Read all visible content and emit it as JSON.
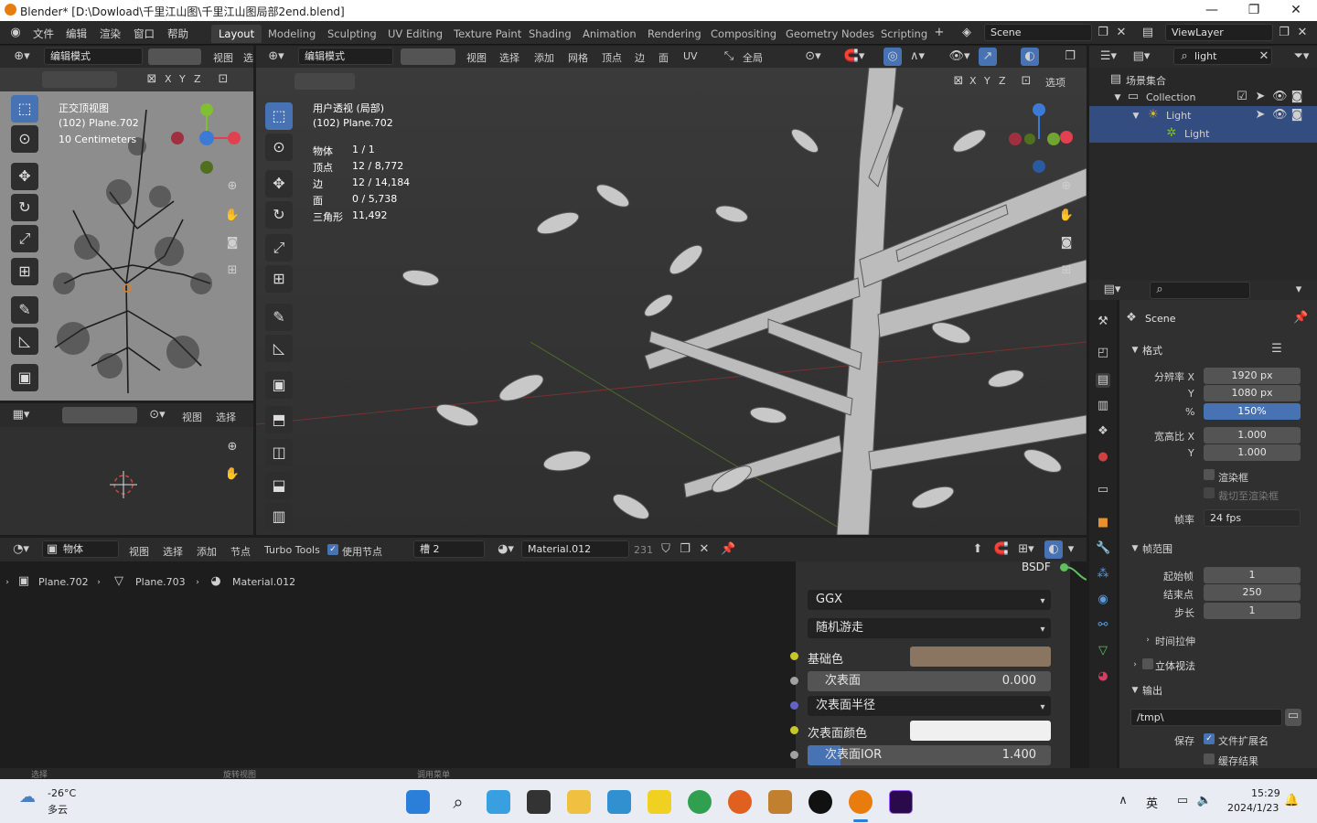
{
  "window": {
    "title": "Blender* [D:\\Dowload\\千里江山图\\千里江山图局部2end.blend]",
    "min": "—",
    "max": "❐",
    "close": "✕"
  },
  "menu": [
    "文件",
    "编辑",
    "渲染",
    "窗口",
    "帮助"
  ],
  "workspaces": [
    "Layout",
    "Modeling",
    "Sculpting",
    "UV Editing",
    "Texture Paint",
    "Shading",
    "Animation",
    "Rendering",
    "Compositing",
    "Geometry Nodes",
    "Scripting"
  ],
  "scene_field": "Scene",
  "viewlayer_field": "ViewLayer",
  "left_viewport": {
    "mode": "编辑模式",
    "menu": [
      "视图",
      "选"
    ],
    "axes": [
      "X",
      "Y",
      "Z"
    ],
    "info": [
      "正交顶视图",
      "(102) Plane.702",
      "10 Centimeters"
    ]
  },
  "uv_editor": {
    "menu": [
      "视图",
      "选择"
    ]
  },
  "main_viewport": {
    "mode": "编辑模式",
    "menu": [
      "视图",
      "选择",
      "添加",
      "网格",
      "顶点",
      "边",
      "面",
      "UV"
    ],
    "transform": "全局",
    "axes": [
      "X",
      "Y",
      "Z"
    ],
    "options": "选项",
    "view_name": "用户透视 (局部)",
    "object_name": "(102) Plane.702",
    "stats": [
      {
        "label": "物体",
        "value": "1 / 1"
      },
      {
        "label": "顶点",
        "value": "12 / 8,772"
      },
      {
        "label": "边",
        "value": "12 / 14,184"
      },
      {
        "label": "面",
        "value": "0 / 5,738"
      },
      {
        "label": "三角形",
        "value": "11,492"
      }
    ]
  },
  "outliner": {
    "search": "light",
    "items": [
      {
        "label": "场景集合"
      },
      {
        "label": "Collection"
      },
      {
        "label": "Light"
      },
      {
        "label": "Light"
      }
    ]
  },
  "properties": {
    "scene": "Scene",
    "format_section": "格式",
    "res_x_label": "分辨率 X",
    "res_x": "1920 px",
    "res_y_label": "Y",
    "res_y": "1080 px",
    "pct_label": "%",
    "pct": "150%",
    "aspect_x_label": "宽高比 X",
    "aspect_x": "1.000",
    "aspect_y_label": "Y",
    "aspect_y": "1.000",
    "render_region": "渲染框",
    "crop_region": "裁切至渲染框",
    "fps_label": "帧率",
    "fps": "24 fps",
    "frame_range_section": "帧范围",
    "frame_start_label": "起始帧",
    "frame_start": "1",
    "frame_end_label": "结束点",
    "frame_end": "250",
    "frame_step_label": "步长",
    "frame_step": "1",
    "time_stretch": "时间拉伸",
    "stereoscopy": "立体视法",
    "output_section": "输出",
    "output_path": "/tmp\\",
    "save_label": "保存",
    "file_ext": "文件扩展名",
    "cache_result": "缓存结果"
  },
  "node_editor": {
    "type": "物体",
    "menu": [
      "视图",
      "选择",
      "添加",
      "节点"
    ],
    "turbo_tools": "Turbo Tools",
    "use_nodes": "使用节点",
    "slot": "槽 2",
    "material": "Material.012",
    "users": "231",
    "breadcrumb": [
      "Plane.702",
      "Plane.703",
      "Material.012"
    ],
    "bsdf_label": "BSDF",
    "distribution": "GGX",
    "subsurface_method": "随机游走",
    "base_color_label": "基础色",
    "subsurface_label": "次表面",
    "subsurface_value": "0.000",
    "subsurface_radius_label": "次表面半径",
    "subsurface_color_label": "次表面颜色",
    "subsurface_ior_label": "次表面IOR",
    "subsurface_ior_value": "1.400",
    "colors": {
      "base": "#8a7560",
      "subsurface": "#f0f0f0"
    }
  },
  "status_bar": [
    "选择",
    "旋转视图",
    "调用菜单"
  ],
  "taskbar": {
    "weather_temp": "-26°C",
    "weather_desc": "多云",
    "lang": "英",
    "time": "15:29",
    "date": "2024/1/23"
  }
}
